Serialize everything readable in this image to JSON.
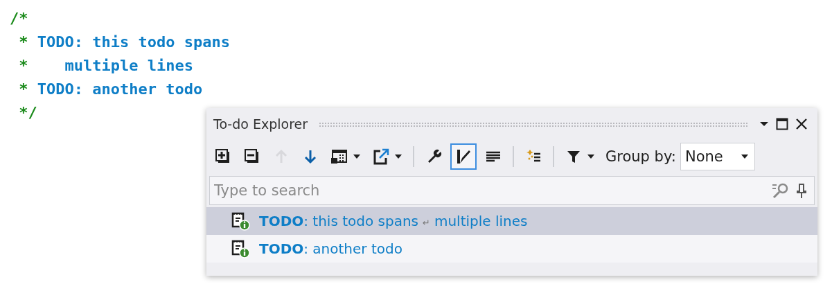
{
  "code_lines": [
    {
      "kind": "open",
      "marker": "/*"
    },
    {
      "kind": "body",
      "marker": "*",
      "text": "TODO: this todo spans"
    },
    {
      "kind": "continuation",
      "marker": "*",
      "text": "multiple lines"
    },
    {
      "kind": "body",
      "marker": "*",
      "text": "TODO: another todo"
    },
    {
      "kind": "close",
      "marker": "*/"
    }
  ],
  "panel": {
    "title": "To-do Explorer",
    "toolbar": [
      {
        "kind": "expand",
        "dropdown": false,
        "disabled": false,
        "selected": false
      },
      {
        "kind": "collapse",
        "dropdown": false,
        "disabled": false,
        "selected": false
      },
      {
        "kind": "up",
        "dropdown": false,
        "disabled": true,
        "selected": false
      },
      {
        "kind": "down",
        "dropdown": false,
        "disabled": false,
        "selected": false
      },
      {
        "kind": "calendar",
        "dropdown": true,
        "disabled": false,
        "selected": false
      },
      {
        "kind": "export",
        "dropdown": true,
        "disabled": false,
        "selected": false
      },
      {
        "kind": "separator"
      },
      {
        "kind": "wrench",
        "dropdown": false,
        "disabled": false,
        "selected": false
      },
      {
        "kind": "pen",
        "dropdown": false,
        "disabled": false,
        "selected": true
      },
      {
        "kind": "lines",
        "dropdown": false,
        "disabled": false,
        "selected": false
      },
      {
        "kind": "separator"
      },
      {
        "kind": "sparkle",
        "dropdown": false,
        "disabled": false,
        "selected": false
      },
      {
        "kind": "separator"
      },
      {
        "kind": "filter",
        "dropdown": true,
        "disabled": false,
        "selected": false
      }
    ],
    "group_by": {
      "label": "Group by:",
      "value": "None"
    },
    "search": {
      "placeholder": "Type to search"
    },
    "items": [
      {
        "tag": "TODO",
        "parts": [
          {
            "kind": "text",
            "text": ": this todo spans"
          },
          {
            "kind": "break",
            "text": "↵"
          },
          {
            "kind": "text",
            "text": "multiple lines"
          }
        ],
        "selected": true
      },
      {
        "tag": "TODO",
        "parts": [
          {
            "kind": "text",
            "text": ": another todo"
          }
        ],
        "selected": false
      }
    ]
  }
}
